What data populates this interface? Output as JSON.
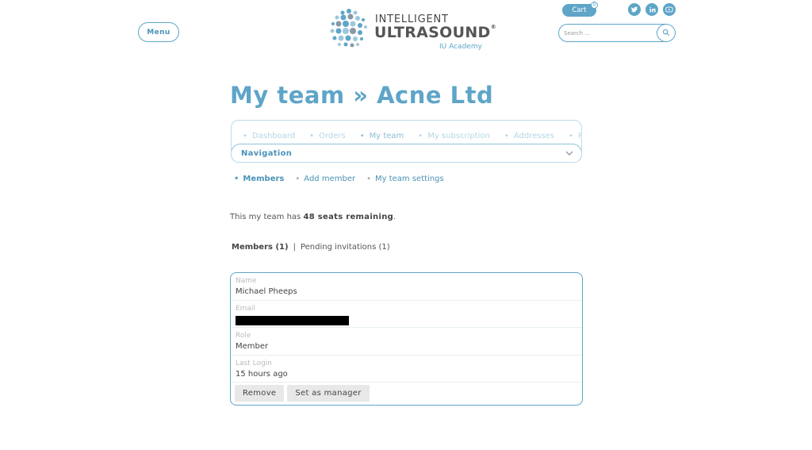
{
  "header": {
    "menu_label": "Menu",
    "logo": {
      "line1": "INTELLIGENT",
      "line2": "ULTRASOUND",
      "reg": "®",
      "sub": "IU Academy"
    },
    "cart": {
      "label": "Cart",
      "count": "0"
    },
    "search": {
      "placeholder": "Search ..."
    },
    "social": [
      "twitter-icon",
      "linkedin-icon",
      "youtube-icon"
    ],
    "accent": "#5ea5c8"
  },
  "main": {
    "title": "My team » Acne Ltd",
    "account_nav": {
      "items": [
        "Dashboard",
        "Orders",
        "My team",
        "My subscription",
        "Addresses",
        "Payme"
      ],
      "active": "My team",
      "toggle_label": "Navigation"
    },
    "subnav": {
      "items": [
        "Members",
        "Add member",
        "My team settings"
      ],
      "active": "Members"
    },
    "seats": {
      "prefix": "This my team has ",
      "value": "48 seats remaining",
      "suffix": "."
    },
    "tabs": {
      "members": "Members (1)",
      "separator": "|",
      "pending": "Pending invitations (1)"
    },
    "member": {
      "name_label": "Name",
      "name": "Michael Pheeps",
      "email_label": "Email",
      "role_label": "Role",
      "role": "Member",
      "login_label": "Last Login",
      "login": "15 hours ago",
      "remove_label": "Remove",
      "manager_label": "Set as manager"
    }
  }
}
